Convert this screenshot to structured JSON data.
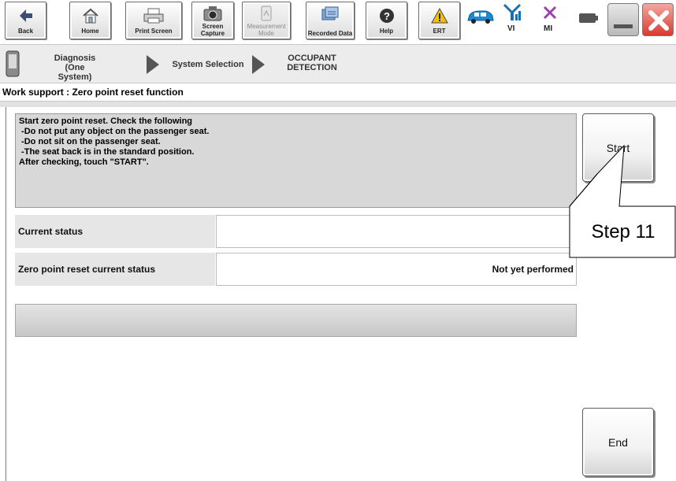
{
  "toolbar": {
    "buttons": [
      {
        "label": "Back",
        "icon": "back-arrow-icon"
      },
      {
        "label": "Home",
        "icon": "home-icon"
      },
      {
        "label": "Print Screen",
        "icon": "printer-icon"
      },
      {
        "label": "Screen Capture",
        "icon": "camera-icon"
      },
      {
        "label": "Measurement Mode",
        "icon": "measurement-icon",
        "disabled": true
      },
      {
        "label": "Recorded Data",
        "icon": "recorded-data-icon"
      },
      {
        "label": "Help",
        "icon": "help-icon"
      },
      {
        "label": "ERT",
        "icon": "warning-icon"
      }
    ],
    "status": {
      "vi_label": "VI",
      "mi_label": "MI"
    }
  },
  "breadcrumb": {
    "item1": "Diagnosis (One System)",
    "item2": "System Selection",
    "item3": "OCCUPANT DETECTION"
  },
  "work_support": {
    "title": "Work support : Zero point reset function",
    "instructions": [
      "Start zero point reset. Check the following",
      " -Do not put any object on the passenger seat.",
      " -Do not sit on the passenger seat.",
      " -The seat back is in the standard position.",
      "After checking, touch \"START\"."
    ],
    "rows": [
      {
        "label": "Current status",
        "value": ""
      },
      {
        "label": "Zero point reset current status",
        "value": "Not yet performed"
      }
    ]
  },
  "buttons": {
    "start": "Start",
    "end": "End"
  },
  "callout": {
    "text": "Step 11"
  },
  "colors": {
    "accent_blue": "#1a8ad4",
    "mi_purple": "#9b3fb3",
    "close_red": "#d83a2e",
    "warning_yellow": "#f2c200"
  }
}
